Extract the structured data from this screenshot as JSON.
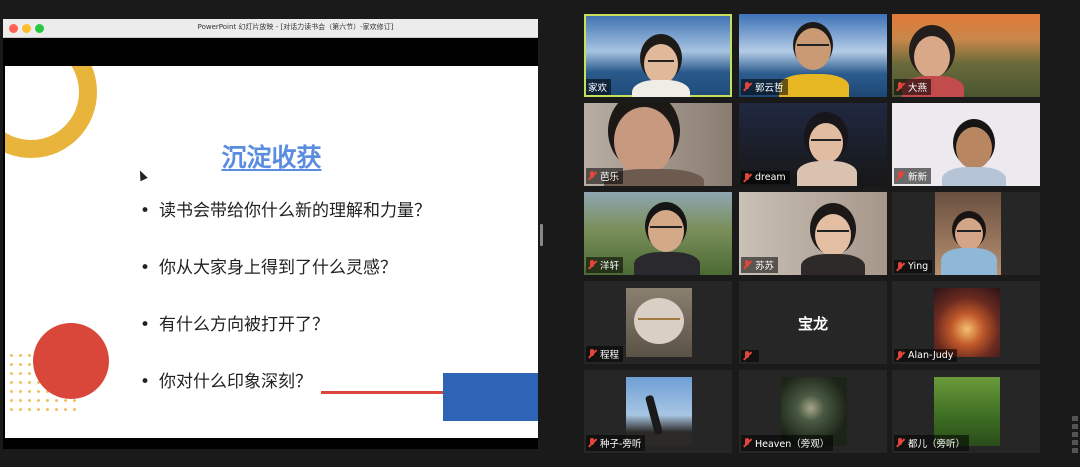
{
  "window": {
    "title": "PowerPoint 幻灯片放映 - [对话力读书会（第六节）-家欢修订]",
    "traffic_lights": {
      "close": "#ff5f57",
      "minimize": "#febc2e",
      "zoom": "#28c840"
    }
  },
  "slide": {
    "title": "沉淀收获",
    "bullets": [
      "读书会带给你什么新的理解和力量？",
      "你从大家身上得到了什么灵感？",
      "有什么方向被打开了？",
      "你对什么印象深刻？"
    ],
    "colors": {
      "title": "#5a8de0",
      "ring": "#e9b43c",
      "red": "#d8473a",
      "blue": "#2f63b5"
    }
  },
  "gallery": {
    "speaking_color": "#c7e05a",
    "muted_icon": "muted-mic-icon",
    "participants": [
      {
        "name": "家欢",
        "muted": false,
        "speaking": true
      },
      {
        "name": "郭云哲",
        "muted": true
      },
      {
        "name": "大燕",
        "muted": true
      },
      {
        "name": "芭乐",
        "muted": true
      },
      {
        "name": "dream",
        "muted": true
      },
      {
        "name": "新新",
        "muted": true
      },
      {
        "name": "洋轩",
        "muted": true
      },
      {
        "name": "苏苏",
        "muted": true
      },
      {
        "name": "Ying",
        "muted": true
      },
      {
        "name": "程程",
        "muted": true
      },
      {
        "name": "",
        "muted": true,
        "video_off_label": "宝龙"
      },
      {
        "name": "Alan-Judy",
        "muted": true
      },
      {
        "name": "种子-旁听",
        "muted": true
      },
      {
        "name": "Heaven（旁观）",
        "muted": true
      },
      {
        "name": "都儿（旁听）",
        "muted": true
      }
    ]
  }
}
